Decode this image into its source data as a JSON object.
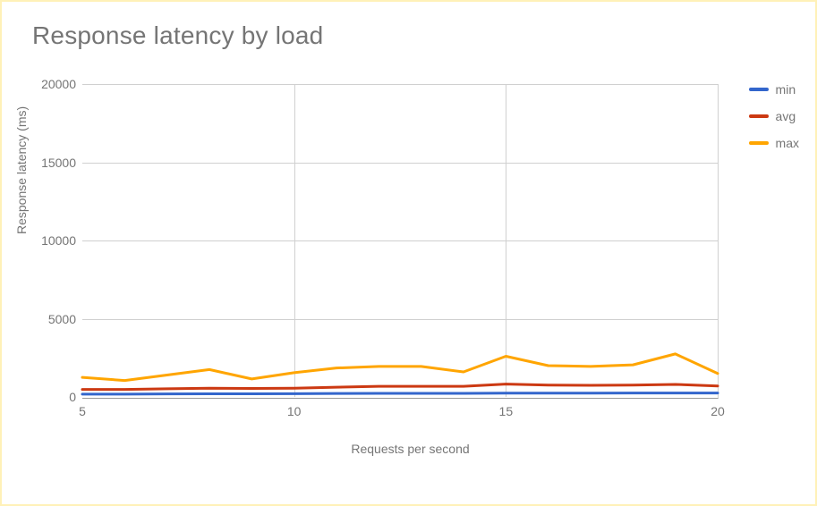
{
  "chart_data": {
    "type": "line",
    "title": "Response latency by load",
    "xlabel": "Requests per second",
    "ylabel": "Response latency (ms)",
    "xlim": [
      5,
      20
    ],
    "ylim": [
      0,
      20000
    ],
    "x_ticks": [
      5,
      10,
      15,
      20
    ],
    "y_ticks": [
      0,
      5000,
      10000,
      15000,
      20000
    ],
    "x": [
      5,
      6,
      7,
      8,
      9,
      10,
      11,
      12,
      13,
      14,
      15,
      16,
      17,
      18,
      19,
      20
    ],
    "series": [
      {
        "name": "min",
        "color": "#3366cc",
        "values": [
          180,
          180,
          190,
          200,
          200,
          210,
          220,
          230,
          230,
          230,
          240,
          240,
          240,
          250,
          250,
          250
        ]
      },
      {
        "name": "avg",
        "color": "#cc3912",
        "values": [
          480,
          480,
          520,
          560,
          540,
          560,
          620,
          680,
          680,
          680,
          820,
          760,
          740,
          760,
          800,
          700
        ]
      },
      {
        "name": "max",
        "color": "#ffa500",
        "values": [
          1250,
          1050,
          1400,
          1750,
          1150,
          1550,
          1850,
          1950,
          1950,
          1600,
          2600,
          2000,
          1950,
          2050,
          2750,
          1500
        ]
      }
    ],
    "legend_position": "right",
    "grid": true
  }
}
